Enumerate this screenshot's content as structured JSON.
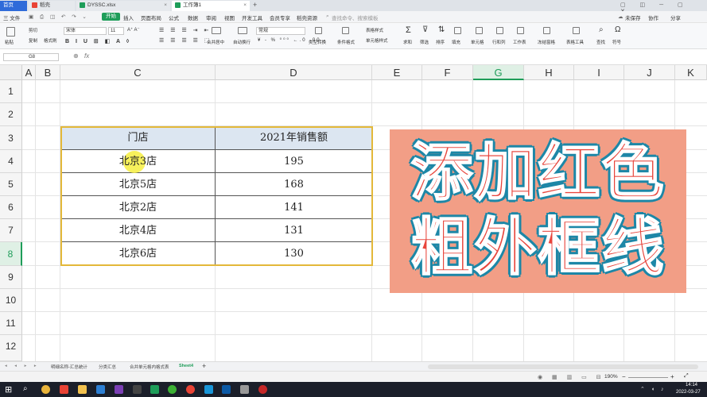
{
  "window_tabs": [
    {
      "label": "首页",
      "active": false
    },
    {
      "label": "稻壳",
      "active": false
    },
    {
      "label": "DYSSC.xlsx",
      "active": false
    },
    {
      "label": "工作簿1",
      "active": true
    }
  ],
  "menu": {
    "file": "三 文件",
    "items": [
      "开始",
      "插入",
      "页面布局",
      "公式",
      "数据",
      "审阅",
      "视图",
      "开发工具",
      "会员专享",
      "稻壳资源"
    ],
    "search": "查找命令、搜索模板",
    "right": [
      "未保存",
      "协作",
      "分享"
    ]
  },
  "ribbon": {
    "paste": "粘贴",
    "cut": "剪切",
    "copy": "复制",
    "format_painter": "格式刷",
    "font_name": "宋体",
    "font_size": "11",
    "merge": "合并居中",
    "wrap": "自动换行",
    "number_format": "常规",
    "type_convert": "类型转换",
    "cond_format": "条件格式",
    "table_style": "表格样式",
    "cell_style": "单元格样式",
    "sum": "求和",
    "filter": "筛选",
    "sort": "排序",
    "fill": "填充",
    "cell": "单元格",
    "row_col": "行和列",
    "worksheet": "工作表",
    "freeze": "冻结窗格",
    "table_tools": "表格工具",
    "find": "查找",
    "symbol": "符号"
  },
  "formula_bar": {
    "name_box": "G8",
    "fx": "fx",
    "value": ""
  },
  "columns": [
    "A",
    "B",
    "C",
    "D",
    "E",
    "F",
    "G",
    "H",
    "I",
    "J",
    "K"
  ],
  "selected_column": "G",
  "rows": [
    "1",
    "2",
    "3",
    "4",
    "5",
    "6",
    "7",
    "8",
    "9",
    "10",
    "11",
    "12"
  ],
  "selected_row": "8",
  "table": {
    "headers": [
      "门店",
      "2021年销售额"
    ],
    "rows": [
      [
        "北京3店",
        "195"
      ],
      [
        "北京5店",
        "168"
      ],
      [
        "北京2店",
        "141"
      ],
      [
        "北京4店",
        "131"
      ],
      [
        "北京6店",
        "130"
      ]
    ]
  },
  "banner": {
    "line1": "添加红色",
    "line2": "粗外框线"
  },
  "sheet_tabs": [
    "明细名称-汇总统计",
    "分类汇总",
    "合并单元格内格式表",
    "Sheet4"
  ],
  "active_sheet": "Sheet4",
  "ime_label": "S 中",
  "status": {
    "zoom": "190%"
  },
  "taskbar": {
    "time": "14:14",
    "date": "2022-03-27"
  },
  "colors": {
    "accent": "#1e9d59",
    "table_border": "#e3b839",
    "header_fill": "#dce6f1",
    "banner_bg": "#f29e86",
    "banner_text": "#e8453c",
    "banner_outline": "#1d87a7"
  }
}
